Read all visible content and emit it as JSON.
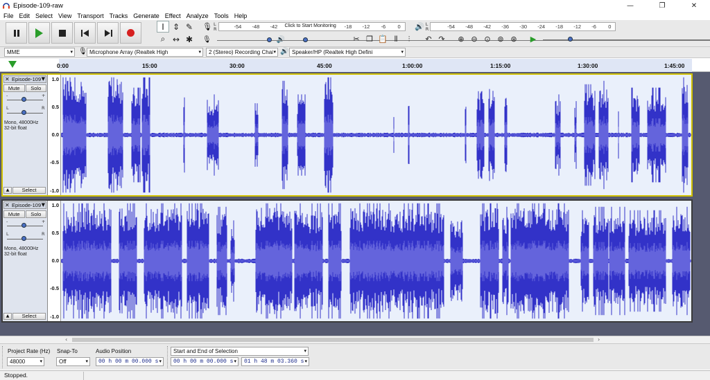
{
  "window": {
    "title": "Episode-109-raw",
    "controls": [
      "—",
      "❐",
      "✕"
    ]
  },
  "menu": [
    "File",
    "Edit",
    "Select",
    "View",
    "Transport",
    "Tracks",
    "Generate",
    "Effect",
    "Analyze",
    "Tools",
    "Help"
  ],
  "transport": {
    "buttons": [
      "pause",
      "play",
      "stop",
      "skip-to-start",
      "skip-to-end",
      "record"
    ]
  },
  "meters": {
    "record_ticks": [
      "-54",
      "-48",
      "-42",
      "-18",
      "-12",
      "-6",
      "0"
    ],
    "record_prompt": "Click to Start Monitoring",
    "playback_ticks": [
      "-54",
      "-48",
      "-42",
      "-36",
      "-30",
      "-24",
      "-18",
      "-12",
      "-6",
      "0"
    ],
    "lr": [
      "L",
      "R"
    ]
  },
  "device": {
    "host": "MME",
    "input": "Microphone Array (Realtek High",
    "channels": "2 (Stereo) Recording Chai",
    "output": "Speaker/HP (Realtek High Defini"
  },
  "timeline": {
    "ticks": [
      "0:00",
      "15:00",
      "30:00",
      "45:00",
      "1:00:00",
      "1:15:00",
      "1:30:00",
      "1:45:00"
    ]
  },
  "tracks": [
    {
      "name": "Episode-109",
      "mute": "Mute",
      "solo": "Solo",
      "gain_minus": "-",
      "gain_plus": "+",
      "pan_l": "L",
      "pan_r": "R",
      "info_rate": "Mono, 48000Hz",
      "info_format": "32-bit float",
      "select": "Select",
      "scale": [
        "1.0",
        "0.5",
        "0.0",
        "-0.5",
        "-1.0"
      ],
      "selected": true
    },
    {
      "name": "Episode-109",
      "mute": "Mute",
      "solo": "Solo",
      "gain_minus": "-",
      "gain_plus": "+",
      "pan_l": "L",
      "pan_r": "R",
      "info_rate": "Mono, 48000Hz",
      "info_format": "32-bit float",
      "select": "Select",
      "scale": [
        "1.0",
        "0.5",
        "0.0",
        "-0.5",
        "-1.0"
      ],
      "selected": false
    }
  ],
  "selection_bar": {
    "project_rate_label": "Project Rate (Hz)",
    "project_rate": "48000",
    "snap_label": "Snap-To",
    "snap_value": "Off",
    "audio_position_label": "Audio Position",
    "audio_position": "00 h 00 m 00.000 s",
    "selection_mode": "Start and End of Selection",
    "selection_start": "00 h 00 m 00.000 s",
    "selection_end": "01 h 48 m 03.360 s"
  },
  "status": "Stopped.",
  "colors": {
    "waveform": "#3232c8",
    "waveform_rms": "#6464dc",
    "track_bg": "#eaf0fb",
    "selected_border": "#d0c000",
    "play_accent": "#2a9d2a",
    "record_accent": "#d62020"
  }
}
